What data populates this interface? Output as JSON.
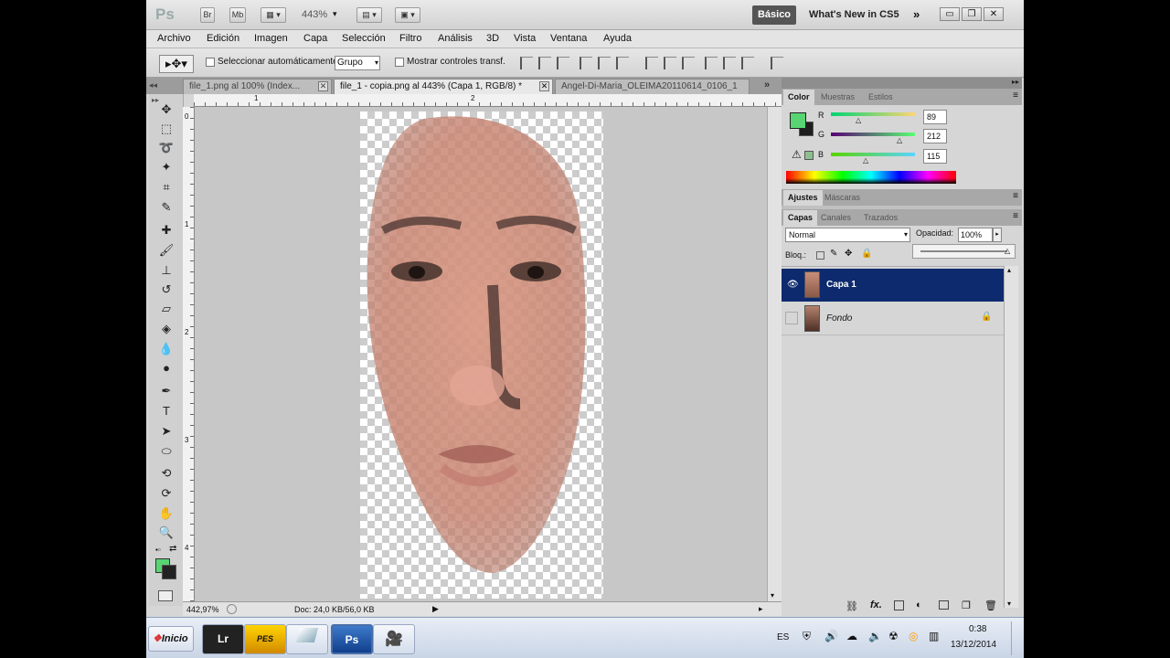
{
  "app": {
    "logo": "Ps",
    "buttons": [
      "Br",
      "Mb"
    ],
    "zoom": "443%",
    "workspace": "Básico",
    "whats_new": "What's New in CS5"
  },
  "menu": [
    "Archivo",
    "Edición",
    "Imagen",
    "Capa",
    "Selección",
    "Filtro",
    "Análisis",
    "3D",
    "Vista",
    "Ventana",
    "Ayuda"
  ],
  "options": {
    "auto_select_label": "Seleccionar automáticamente:",
    "auto_select_value": "Grupo",
    "show_transform_label": "Mostrar controles transf."
  },
  "tabs": [
    {
      "label": "file_1.png al 100% (Index..."
    },
    {
      "label": "file_1 - copia.png al 443% (Capa 1, RGB/8) *"
    },
    {
      "label": "Angel-Di-Maria_OLEIMA20110614_0106_1"
    }
  ],
  "rulers": {
    "top": [
      "1",
      "2"
    ],
    "left": [
      "0",
      "1",
      "2",
      "3",
      "4"
    ]
  },
  "status": {
    "zoom": "442,97%",
    "doc": "Doc: 24,0 KB/56,0 KB"
  },
  "color_panel": {
    "tabs": [
      "Color",
      "Muestras",
      "Estilos"
    ],
    "r_label": "R",
    "g_label": "G",
    "b_label": "B",
    "r": "89",
    "g": "212",
    "b": "115",
    "fg_color": "#59d473"
  },
  "adjust_panel": {
    "tabs": [
      "Ajustes",
      "Máscaras"
    ]
  },
  "layers_panel": {
    "tabs": [
      "Capas",
      "Canales",
      "Trazados"
    ],
    "blend_mode": "Normal",
    "opacity_label": "Opacidad:",
    "opacity": "100%",
    "lock_label": "Bloq.:",
    "layers": [
      {
        "name": "Capa 1"
      },
      {
        "name": "Fondo"
      }
    ]
  },
  "taskbar": {
    "start": "Inicio",
    "lang": "ES",
    "time": "0:38",
    "date": "13/12/2014",
    "apps": [
      "Lr",
      "PES",
      "",
      "Ps",
      ""
    ]
  }
}
